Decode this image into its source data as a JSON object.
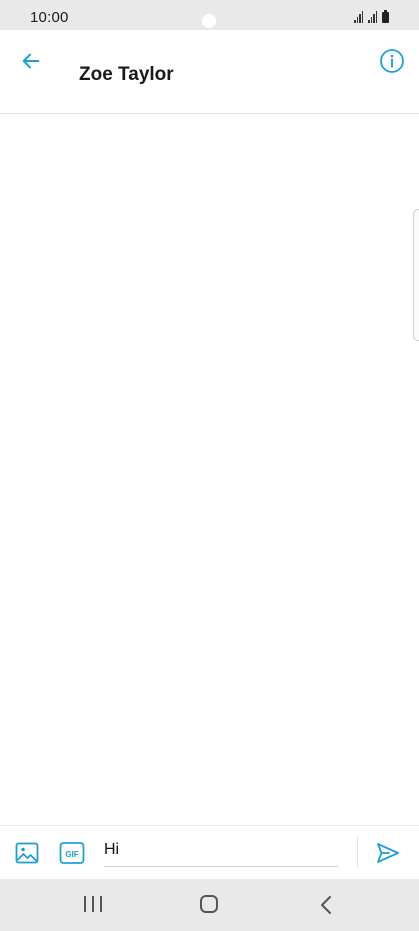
{
  "status_bar": {
    "time": "10:00"
  },
  "header": {
    "contact_name": "Zoe Taylor",
    "back_icon": "arrow-left-icon",
    "info_icon": "info-icon"
  },
  "composer": {
    "message_value": "Hi",
    "image_icon": "image-icon",
    "gif_icon": "gif-icon",
    "gif_label": "GIF",
    "send_icon": "send-icon"
  },
  "nav_bar": {
    "recents_icon": "recents-icon",
    "home_icon": "home-icon",
    "back_icon": "back-chevron-icon"
  },
  "colors": {
    "accent": "#1e9fd4",
    "text": "#1a1a1a",
    "system_bar": "#e9e9ea"
  }
}
